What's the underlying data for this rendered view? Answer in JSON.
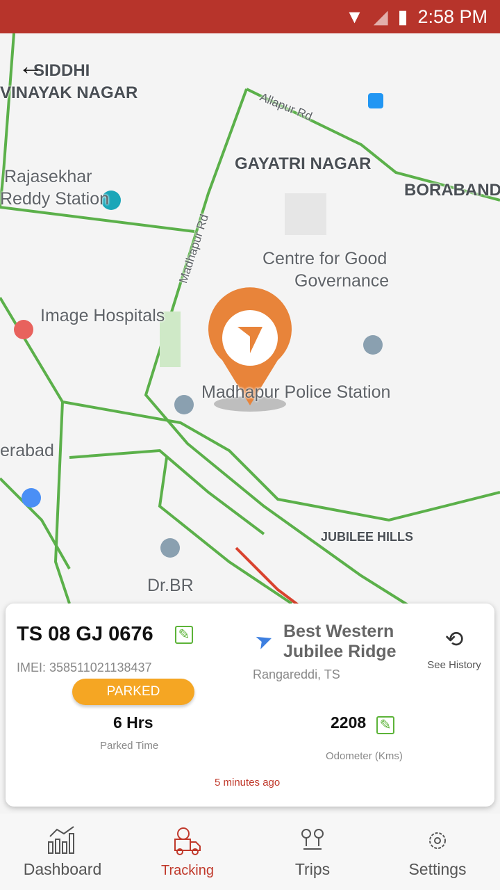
{
  "status_bar": {
    "time": "2:58 PM",
    "icons": [
      "wifi-icon",
      "signal-icon",
      "battery-icon"
    ]
  },
  "map": {
    "labels": [
      "SIDDHI",
      "VINAYAK NAGAR",
      "Allapur Rd",
      "GAYATRI NAGAR",
      "BORABAND",
      "Rajasekhar",
      "Reddy Station",
      "Madhapur Rd",
      "Centre for Good",
      "Governance",
      "Image Hospitals",
      "Madhapur Police Station",
      "erabad",
      "JUBILEE HILLS",
      "Dr.BR"
    ],
    "marker_color": "#e8843a"
  },
  "vehicle": {
    "plate": "TS 08 GJ 0676",
    "imei": "IMEI: 358511021138437",
    "status": "PARKED",
    "status_color": "#f5a623",
    "parked_time": "6 Hrs",
    "parked_time_label": "Parked Time",
    "odometer": "2208",
    "odometer_label": "Odometer (Kms)",
    "updated": "5 minutes ago"
  },
  "location": {
    "name_line1": "Best Western",
    "name_line2": "Jubilee Ridge",
    "region": "Rangareddi, TS"
  },
  "history": {
    "label": "See History"
  },
  "nav": [
    {
      "label": "Dashboard"
    },
    {
      "label": "Tracking",
      "active": true
    },
    {
      "label": "Trips"
    },
    {
      "label": "Settings"
    }
  ],
  "colors": {
    "status_bar": "#b7342b",
    "accent": "#c0392b",
    "edit": "#5cb338"
  }
}
